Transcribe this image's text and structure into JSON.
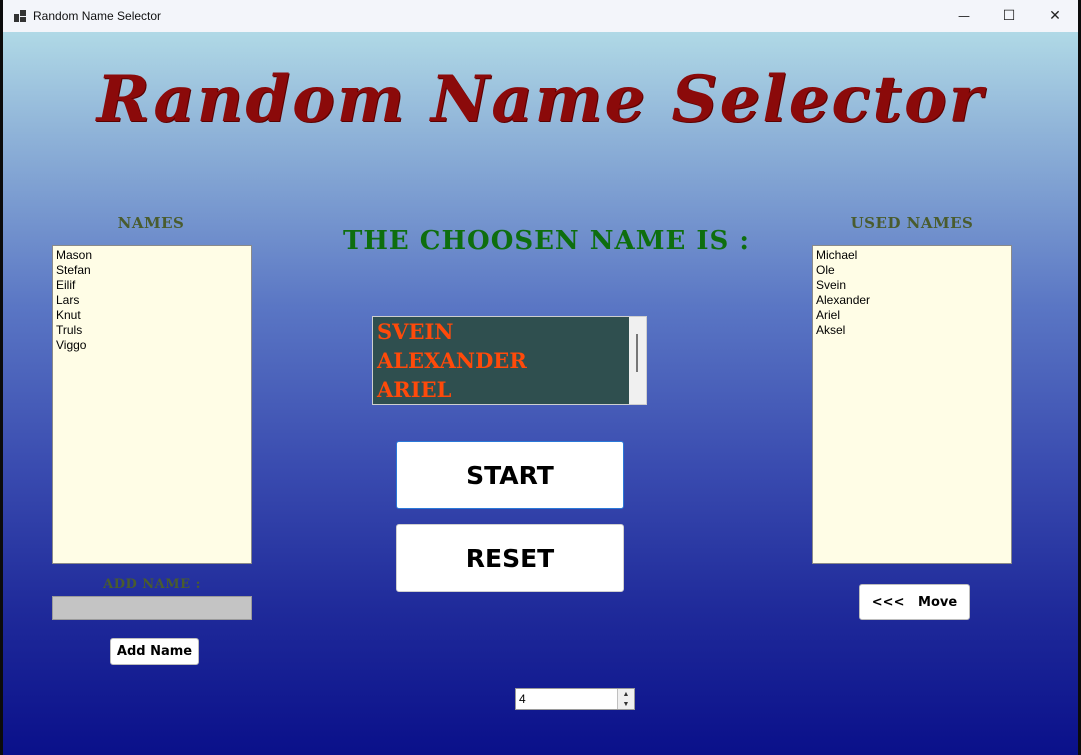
{
  "window": {
    "title": "Random Name Selector",
    "minimize_glyph": "—",
    "maximize_glyph": "☐",
    "close_glyph": "✕"
  },
  "header": {
    "title": "Random Name Selector"
  },
  "names_panel": {
    "label": "NAMES",
    "items": [
      "Mason",
      "Stefan",
      "Eilif",
      "Lars",
      "Knut",
      "Truls",
      "Viggo"
    ],
    "add_label": "ADD NAME :",
    "add_input_value": "",
    "add_button": "Add Name"
  },
  "chosen": {
    "label": "THE CHOOSEN NAME IS :",
    "items": [
      "SVEIN",
      "ALEXANDER",
      "ARIEL"
    ],
    "text_color": "#ff4a0a",
    "bg_color": "#2f4f4f"
  },
  "controls": {
    "start": "START",
    "reset": "RESET",
    "count_value": "4",
    "spin_up": "▲",
    "spin_down": "▼"
  },
  "used_panel": {
    "label": "USED NAMES",
    "items": [
      "Michael",
      "Ole",
      "Svein",
      "Alexander",
      "Ariel",
      "Aksel"
    ],
    "move_button": "<<<   Move"
  },
  "colors": {
    "title": "#8b0a0a",
    "chosen_label": "#0e6e0e",
    "panel_label": "#4a5c2e",
    "listbox_bg": "#fffde6"
  }
}
